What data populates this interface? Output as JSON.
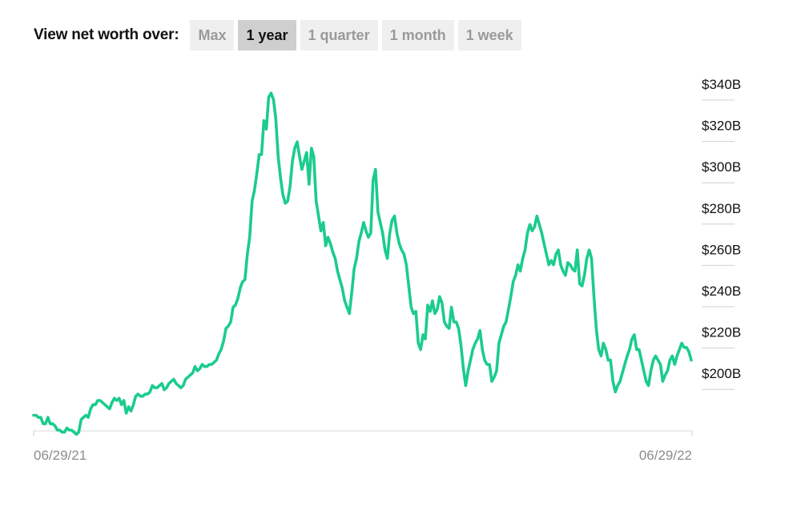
{
  "controls": {
    "label": "View net worth over:",
    "ranges": [
      {
        "label": "Max",
        "active": false
      },
      {
        "label": "1 year",
        "active": true
      },
      {
        "label": "1 quarter",
        "active": false
      },
      {
        "label": "1 month",
        "active": false
      },
      {
        "label": "1 week",
        "active": false
      }
    ]
  },
  "chart_data": {
    "type": "line",
    "x_start_label": "06/29/21",
    "x_end_label": "06/29/22",
    "y_ticks": [
      {
        "value": 340,
        "label": "$340B"
      },
      {
        "value": 320,
        "label": "$320B"
      },
      {
        "value": 300,
        "label": "$300B"
      },
      {
        "value": 280,
        "label": "$280B"
      },
      {
        "value": 260,
        "label": "$260B"
      },
      {
        "value": 240,
        "label": "$240B"
      },
      {
        "value": 220,
        "label": "$220B"
      },
      {
        "value": 200,
        "label": "$200B"
      }
    ],
    "ylim": [
      177,
      341
    ],
    "line_color": "#1bcc8c",
    "values": [
      184,
      184,
      183,
      183,
      180,
      180,
      183,
      180,
      180,
      179,
      177,
      177,
      176,
      176,
      178,
      177,
      177,
      176,
      175,
      176,
      182,
      183,
      184,
      183,
      187,
      189,
      189,
      191,
      191,
      190,
      189,
      188,
      187,
      190,
      192,
      191,
      192,
      189,
      191,
      185,
      188,
      186,
      189,
      193,
      194,
      193,
      193,
      194,
      194,
      195,
      198,
      197,
      197,
      198,
      199,
      196,
      197,
      199,
      200,
      201,
      199,
      198,
      197,
      198,
      201,
      202,
      203,
      204,
      207,
      205,
      206,
      208,
      207,
      207,
      208,
      208,
      209,
      210,
      213,
      215,
      219,
      225,
      226,
      228,
      235,
      236,
      239,
      244,
      247,
      248,
      260,
      268,
      285,
      290,
      298,
      307,
      307,
      323,
      319,
      334,
      336,
      333,
      324,
      306,
      296,
      288,
      284,
      285,
      292,
      304,
      310,
      313,
      306,
      300,
      304,
      308,
      293,
      310,
      306,
      285,
      278,
      271,
      275,
      264,
      268,
      265,
      261,
      258,
      252,
      248,
      244,
      238,
      235,
      232,
      242,
      253,
      258,
      266,
      270,
      275,
      271,
      268,
      270,
      295,
      300,
      280,
      275,
      270,
      262,
      258,
      270,
      276,
      278,
      270,
      265,
      262,
      260,
      255,
      245,
      235,
      232,
      233,
      218,
      215,
      222,
      220,
      236,
      233,
      238,
      232,
      234,
      240,
      237,
      228,
      226,
      225,
      235,
      228,
      228,
      225,
      217,
      206,
      198,
      205,
      210,
      215,
      218,
      220,
      224,
      215,
      210,
      208,
      208,
      200,
      202,
      205,
      218,
      222,
      226,
      228,
      234,
      240,
      247,
      250,
      255,
      252,
      258,
      262,
      270,
      274,
      271,
      273,
      278,
      274,
      270,
      265,
      260,
      255,
      257,
      255,
      260,
      262,
      255,
      252,
      250,
      256,
      255,
      253,
      252,
      262,
      246,
      245,
      250,
      258,
      262,
      258,
      240,
      225,
      215,
      212,
      218,
      215,
      210,
      210,
      200,
      195,
      198,
      200,
      204,
      208,
      212,
      215,
      220,
      222,
      215,
      215,
      210,
      205,
      200,
      198,
      205,
      210,
      212,
      210,
      208,
      200,
      203,
      205,
      210,
      212,
      208,
      212,
      215,
      218,
      216,
      216,
      214,
      210
    ]
  }
}
